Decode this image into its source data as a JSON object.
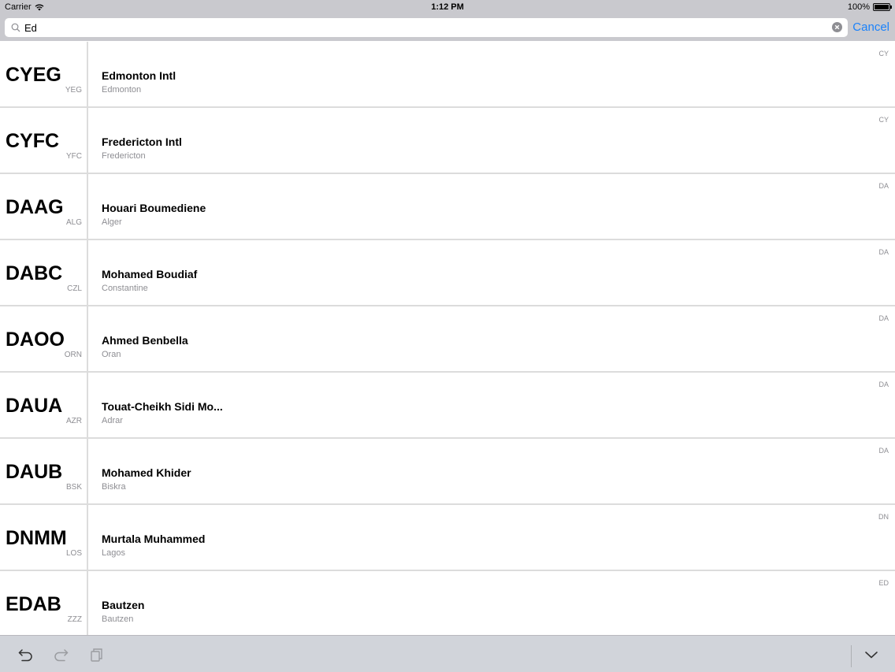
{
  "status_bar": {
    "carrier": "Carrier",
    "time": "1:12 PM",
    "battery": "100%"
  },
  "search": {
    "value": "Ed",
    "cancel_label": "Cancel"
  },
  "results": [
    {
      "icao": "CYEG",
      "iata": "YEG",
      "name": "Edmonton Intl",
      "city": "Edmonton",
      "region": "CY"
    },
    {
      "icao": "CYFC",
      "iata": "YFC",
      "name": "Fredericton Intl",
      "city": "Fredericton",
      "region": "CY"
    },
    {
      "icao": "DAAG",
      "iata": "ALG",
      "name": "Houari Boumediene",
      "city": "Alger",
      "region": "DA"
    },
    {
      "icao": "DABC",
      "iata": "CZL",
      "name": "Mohamed Boudiaf",
      "city": "Constantine",
      "region": "DA"
    },
    {
      "icao": "DAOO",
      "iata": "ORN",
      "name": "Ahmed Benbella",
      "city": "Oran",
      "region": "DA"
    },
    {
      "icao": "DAUA",
      "iata": "AZR",
      "name": "Touat-Cheikh Sidi Mo...",
      "city": "Adrar",
      "region": "DA"
    },
    {
      "icao": "DAUB",
      "iata": "BSK",
      "name": "Mohamed Khider",
      "city": "Biskra",
      "region": "DA"
    },
    {
      "icao": "DNMM",
      "iata": "LOS",
      "name": "Murtala Muhammed",
      "city": "Lagos",
      "region": "DN"
    },
    {
      "icao": "EDAB",
      "iata": "ZZZ",
      "name": "Bautzen",
      "city": "Bautzen",
      "region": "ED"
    }
  ],
  "colors": {
    "accent": "#1a82fb",
    "bar_background": "#c9c9ce",
    "secondary_text": "#8e8e93"
  },
  "toolbar_icons": [
    "undo-icon",
    "redo-icon",
    "paste-icon",
    "dismiss-keyboard-icon"
  ]
}
